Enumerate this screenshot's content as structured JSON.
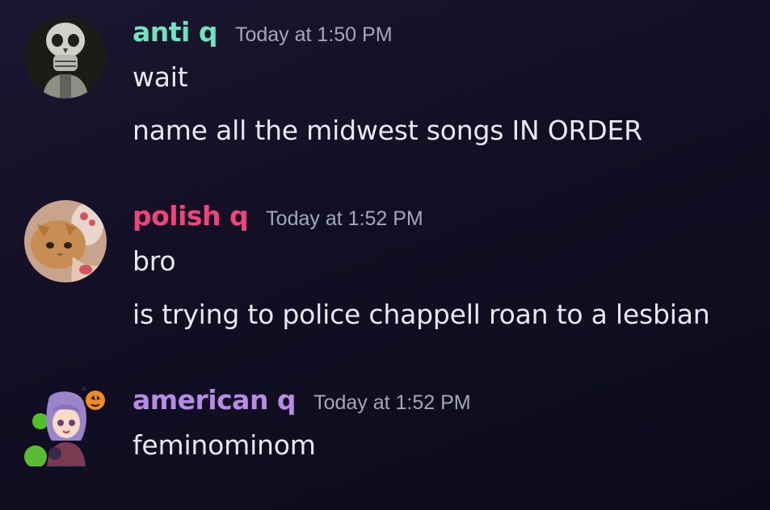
{
  "colors": {
    "background": "#130f26",
    "message_text": "#e9e8ef",
    "timestamp_text": "#a5a8b8"
  },
  "messages": [
    {
      "username": "anti q",
      "username_color": "#6fe3bd",
      "timestamp": "Today at 1:50 PM",
      "avatar_icon": "skull-avatar",
      "lines": [
        "wait",
        "name all the midwest songs IN ORDER"
      ]
    },
    {
      "username": "polish q",
      "username_color": "#f0447a",
      "timestamp": "Today at 1:52 PM",
      "avatar_icon": "cat-avatar",
      "lines": [
        "bro",
        "is trying to police chappell roan to a lesbian"
      ]
    },
    {
      "username": "american q",
      "username_color": "#b78be6",
      "timestamp": "Today at 1:52 PM",
      "avatar_icon": "witch-girl-avatar",
      "lines": [
        "feminominom"
      ]
    }
  ]
}
